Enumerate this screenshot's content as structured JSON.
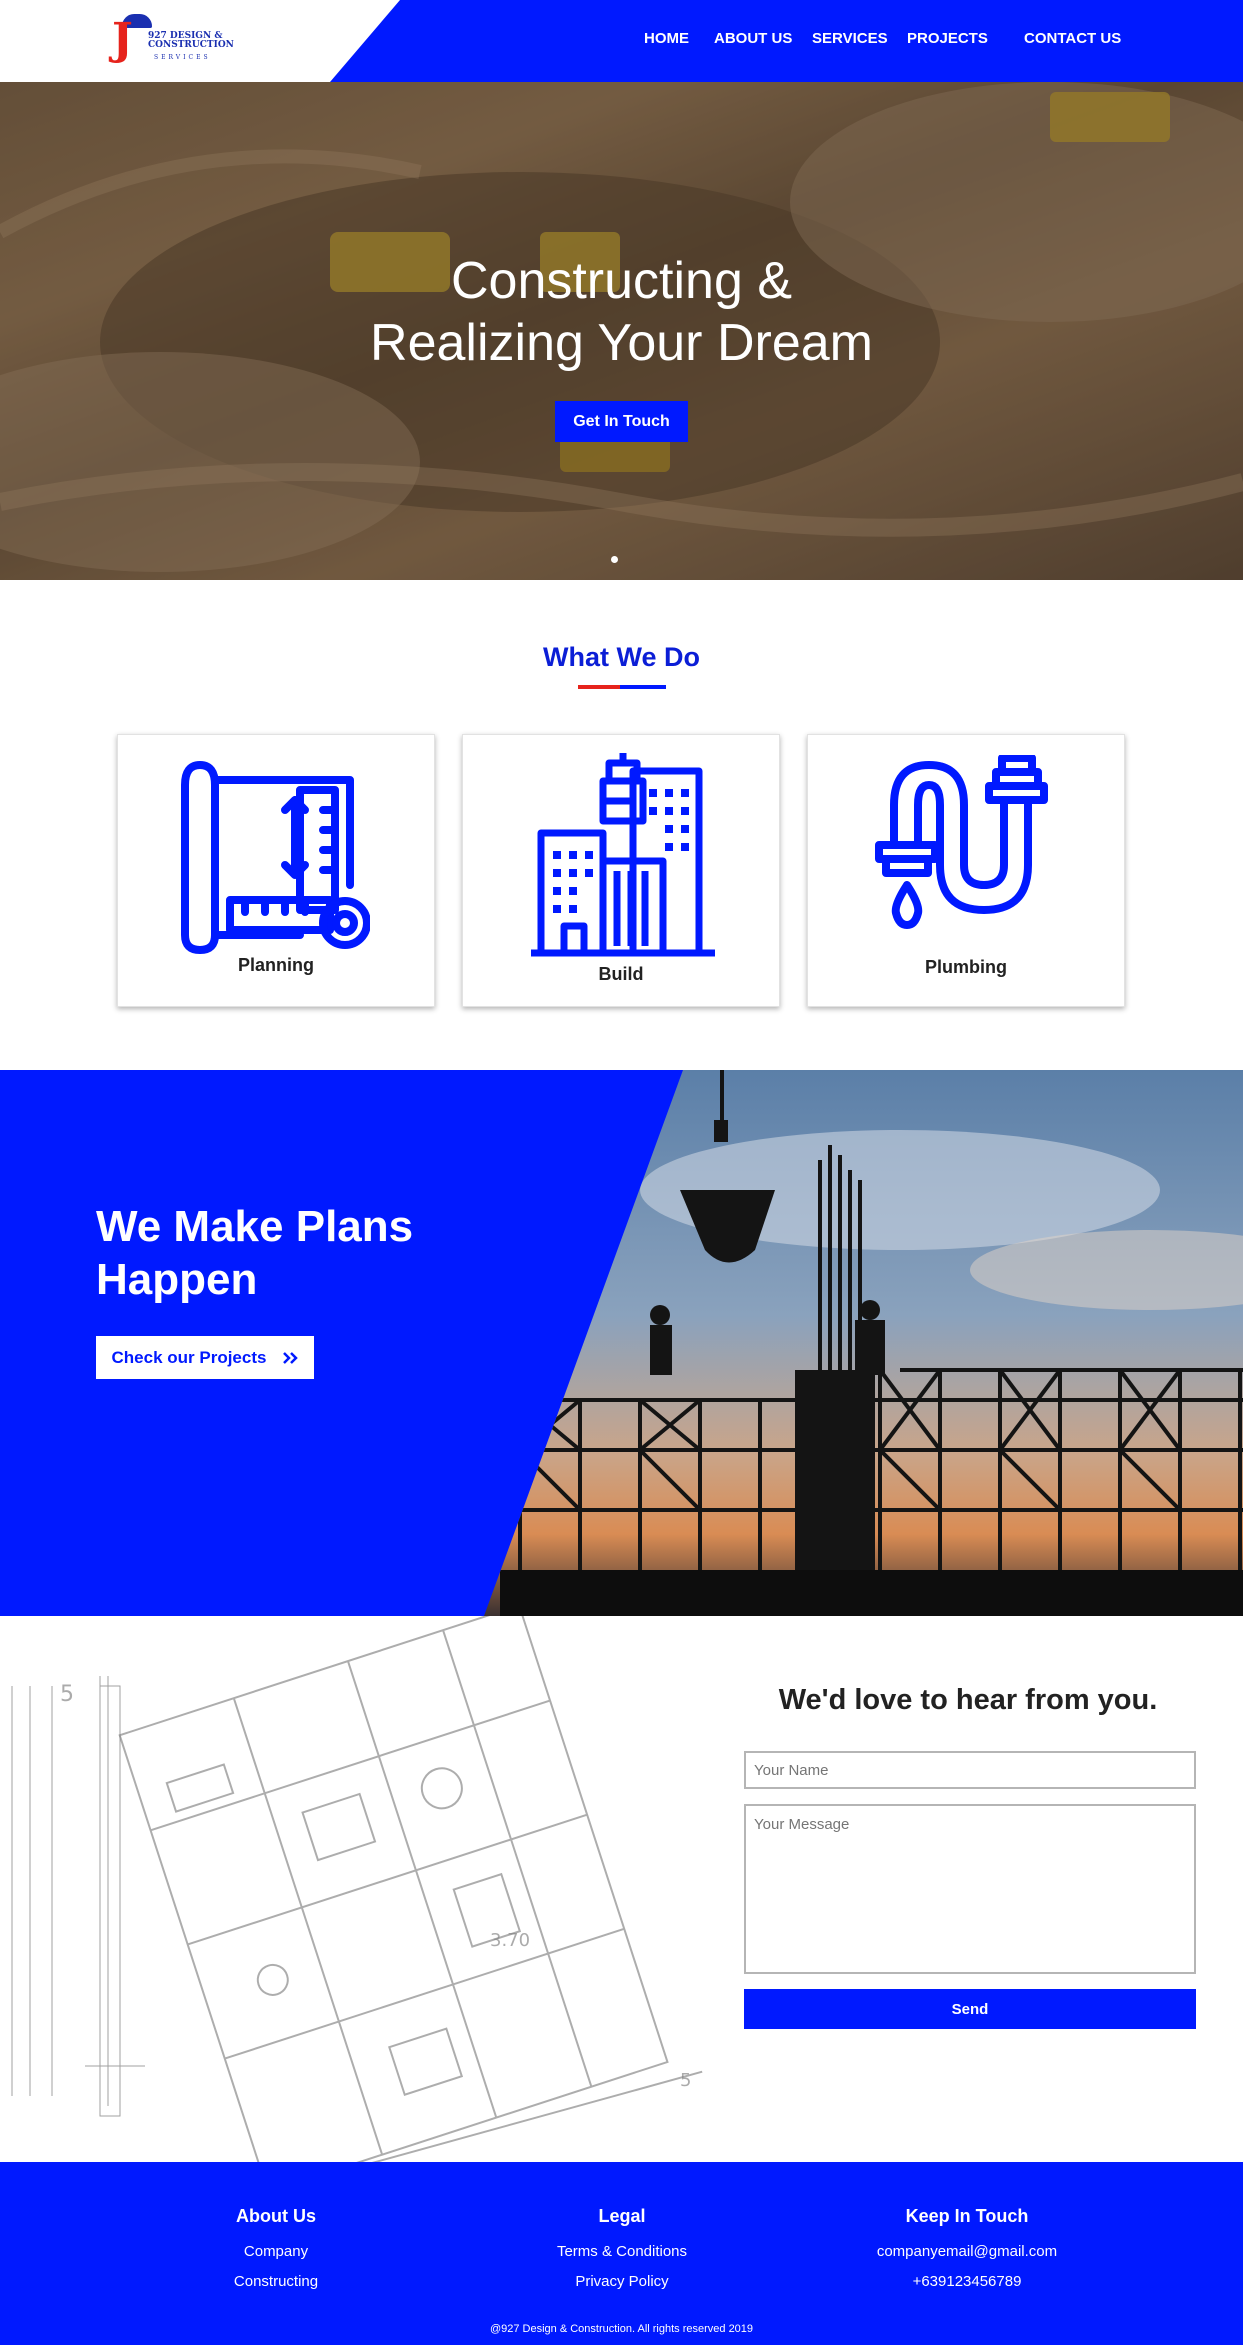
{
  "header": {
    "logo_main": "927 DESIGN &",
    "logo_main2": "CONSTRUCTION",
    "logo_sub": "SERVICES",
    "logo_letter": "J",
    "nav": [
      "HOME",
      "ABOUT US",
      "SERVICES",
      "PROJECTS",
      "CONTACT US"
    ]
  },
  "hero": {
    "title_line1": "Constructing &",
    "title_line2": "Realizing Your Dream",
    "button": "Get In Touch"
  },
  "what_we_do": {
    "title": "What We Do",
    "cards": [
      {
        "label": "Planning",
        "icon": "blueprint-icon"
      },
      {
        "label": "Build",
        "icon": "buildings-icon"
      },
      {
        "label": "Plumbing",
        "icon": "pipe-icon"
      }
    ]
  },
  "plans": {
    "title_line1": "We Make Plans",
    "title_line2": "Happen",
    "button": "Check our Projects",
    "button_icon": "double-chevron-right-icon"
  },
  "contact": {
    "title": "We'd love to hear from you.",
    "name_placeholder": "Your Name",
    "message_placeholder": "Your Message",
    "send": "Send"
  },
  "footer": {
    "about": {
      "title": "About Us",
      "items": [
        "Company",
        "Constructing"
      ]
    },
    "legal": {
      "title": "Legal",
      "items": [
        "Terms & Conditions",
        "Privacy Policy"
      ]
    },
    "keep": {
      "title": "Keep In Touch",
      "items": [
        "companyemail@gmail.com",
        "+639123456789"
      ]
    },
    "copyright": "@927 Design & Construction. All rights reserved 2019"
  },
  "colors": {
    "brand_blue": "#0019ff",
    "accent_red": "#e6231c"
  }
}
